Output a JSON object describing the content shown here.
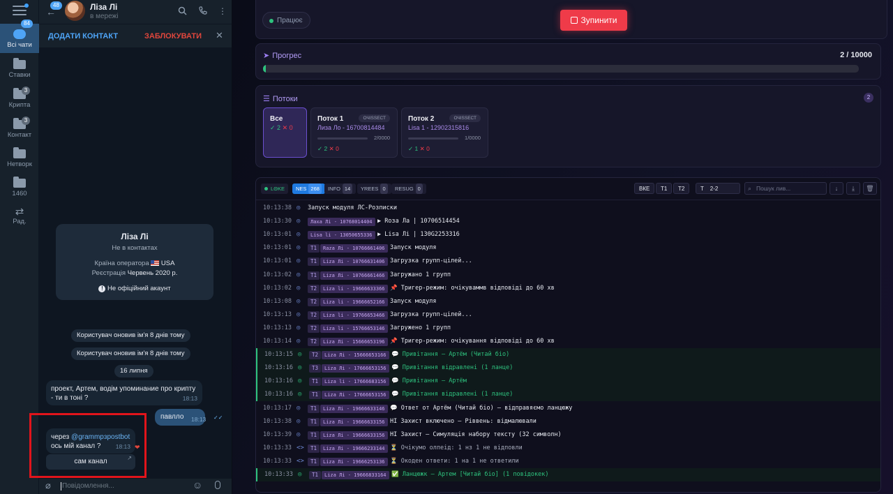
{
  "telegram": {
    "rail": [
      {
        "label": "Всі чати",
        "badge": "84",
        "icon": "chat-bubbles-icon"
      },
      {
        "label": "Ставки",
        "badge": "",
        "icon": "folder-icon"
      },
      {
        "label": "Крипта",
        "badge": "3",
        "icon": "folder-icon"
      },
      {
        "label": "Контакт",
        "badge": "3",
        "icon": "folder-icon"
      },
      {
        "label": "Нетворк",
        "badge": "",
        "icon": "folder-icon"
      },
      {
        "label": "1460",
        "badge": "",
        "icon": "folder-icon"
      },
      {
        "label": "Рад.",
        "badge": "",
        "icon": "arrows-icon"
      }
    ],
    "header": {
      "unread": "48",
      "name": "Ліза Лі",
      "status": "в мережі"
    },
    "actions": {
      "add_contact": "ДОДАТИ КОНТАКТ",
      "block": "ЗАБЛОКУВАТИ"
    },
    "info_card": {
      "name": "Ліза Лі",
      "not_in_contacts": "Не в контактах",
      "operator_label": "Країна оператора",
      "operator_value": "USA",
      "reg_label": "Реєстрація",
      "reg_value": "Червень 2020 р.",
      "unofficial": "Не офіційний акаунт"
    },
    "service": [
      "Користувач оновив ім'я 8 днів тому",
      "Користувач оновив ім'я 8 днів тому",
      "16 липня"
    ],
    "messages": {
      "m1_text": "проект, Артем, водім упоминание про крипту - ти в тоні ?",
      "m1_time": "18:13",
      "m2_text": "павлло",
      "m2_time": "18:13",
      "m3_prefix": "через ",
      "m3_link": "@grammpзpostbot",
      "m3_rest": "ось мій канал ?",
      "m3_time": "18:13",
      "m3_button": "сам канал"
    },
    "input_placeholder": "Повідомлення..."
  },
  "dashboard": {
    "status": "Працює",
    "stop_label": "Зупинити",
    "progress": {
      "title": "Прогрес",
      "count": "2 / 10000",
      "fraction": 0.002
    },
    "threads": {
      "title": "Потоки",
      "count": "2",
      "all": {
        "title": "Все",
        "ok": "✓ 2",
        "err": "✕ 0"
      },
      "cards": [
        {
          "title": "Поток 1",
          "tag": "ОЧІЅЅЕСТ",
          "account": "Лиза Ло - 16700814484",
          "count": "2/0000",
          "ok": "✓ 2",
          "err": "✕ 0"
        },
        {
          "title": "Поток 2",
          "tag": "ОЧІЅЅЕСТ",
          "account": "Lisa 1 - 12902315816",
          "count": "1/0000",
          "ok": "✓ 1",
          "err": "✕ 0"
        }
      ]
    },
    "log": {
      "live": "LΘKE",
      "filters": [
        {
          "label": "NES",
          "count": "268"
        },
        {
          "label": "INFO",
          "count": "14"
        },
        {
          "label": "YREES",
          "count": "0"
        },
        {
          "label": "RESUG",
          "count": "0"
        }
      ],
      "seg_all": "ВКЕ",
      "seg_t1": "T1",
      "seg_t2": "T2",
      "range_t": "T",
      "range_val": "2-2",
      "search_placeholder": "Пошук лив...",
      "rows": [
        {
          "ts": "10:13:38",
          "th": "",
          "acc": "",
          "text": "Запуск модуля ЛС-Розписки",
          "style": "white",
          "hl": false
        },
        {
          "ts": "10:13:30",
          "th": "",
          "acc": "Лаха Лі - 10768014404",
          "text": "▶ Roза Ла | 10706514454",
          "style": "white",
          "hl": false
        },
        {
          "ts": "10:13:01",
          "th": "",
          "acc": "Lisa li - 13050655336",
          "text": "▶ Lisa Лі | 130G2253316",
          "style": "white",
          "hl": false
        },
        {
          "ts": "10:13:01",
          "th": "T1",
          "acc": "Raza Лі - 10766661406",
          "text": "Запуск модуля",
          "style": "white",
          "hl": false
        },
        {
          "ts": "10:13:01",
          "th": "T1",
          "acc": "Liza Лі - 10766631406",
          "text": "Загрузка групп-цілей...",
          "style": "white",
          "hl": false
        },
        {
          "ts": "10:13:02",
          "th": "T1",
          "acc": "Liza Лі - 10766661466",
          "text": "Загружано 1 групп",
          "style": "white",
          "hl": false
        },
        {
          "ts": "10:13:02",
          "th": "T2",
          "acc": "Liza li - 19666633366",
          "text": "📌 Тригер-режим: очікуваммв відповіді до 60 хв",
          "style": "white",
          "hl": false
        },
        {
          "ts": "10:13:08",
          "th": "T2",
          "acc": "Liza li - 19666652166",
          "text": "Запуск модуля",
          "style": "white",
          "hl": false
        },
        {
          "ts": "10:13:13",
          "th": "T2",
          "acc": "Liza li - 19766653466",
          "text": "Загрузка групп-цілей...",
          "style": "white",
          "hl": false
        },
        {
          "ts": "10:13:13",
          "th": "T2",
          "acc": "Liza li - 15766653146",
          "text": "Загружено 1 групп",
          "style": "white",
          "hl": false
        },
        {
          "ts": "10:13:14",
          "th": "T2",
          "acc": "Liza Лі - 15666653196",
          "text": "📌 Тригер-режим: очікування відповіді до 60 хв",
          "style": "white",
          "hl": false
        },
        {
          "ts": "10:13:15",
          "th": "T2",
          "acc": "Liza Лі - 15666653166",
          "text": "💬 Привітання – Артём (Читай біо)",
          "style": "green",
          "hl": true
        },
        {
          "ts": "10:13:16",
          "th": "T3",
          "acc": "Liza Лі - 17666653156",
          "text": "💬 Привітання відравлені (1 ланце)",
          "style": "green",
          "hl": true
        },
        {
          "ts": "10:13:16",
          "th": "T1",
          "acc": "Liza li - 17666683156",
          "text": "💬 Привітання – Артём",
          "style": "green",
          "hl": true
        },
        {
          "ts": "10:13:16",
          "th": "T1",
          "acc": "Liza Лі - 17666653156",
          "text": "💬 Привітання відравлені (1 ланце)",
          "style": "green",
          "hl": true
        },
        {
          "ts": "10:13:17",
          "th": "T1",
          "acc": "Liza Лі - 19666633146",
          "text": "💬 Ответ от Артём (Читай біо) – відправяємо ланцюжу",
          "style": "white",
          "hl": false
        },
        {
          "ts": "10:13:38",
          "th": "T1",
          "acc": "Liza Лі - 19666633156",
          "text": "HI Захист включено – Ріввень: відмалювали",
          "style": "white",
          "hl": false
        },
        {
          "ts": "10:13:39",
          "th": "T1",
          "acc": "Liza Лі - 19666633156",
          "text": "HI Захист – Симуляція набору тексту (32 символн)",
          "style": "white",
          "hl": false
        },
        {
          "ts": "10:13:33",
          "th": "T1",
          "acc": "Liza Лі - 19666233144",
          "text": "⏳ Очікумо олпеід: 1 нз 1 не відповли",
          "style": "grey",
          "hl": false
        },
        {
          "ts": "10:13:33",
          "th": "T1",
          "acc": "Liza Лі - 19666253136",
          "text": "⏳ Окоден ответи: 1 на 1 не ответили",
          "style": "grey",
          "hl": false
        },
        {
          "ts": "10:13:33",
          "th": "T1",
          "acc": "Liza Лі - 19666833164",
          "text": "✅ Ланцюжк – Артем [Читай біо] (1 повідокек)",
          "style": "green",
          "hl": true
        }
      ]
    }
  },
  "colors": {
    "accent_green": "#2ec27e",
    "stop_red": "#ef3b49",
    "purple": "#9d7ff5",
    "tg_blue": "#4ea4f6"
  }
}
